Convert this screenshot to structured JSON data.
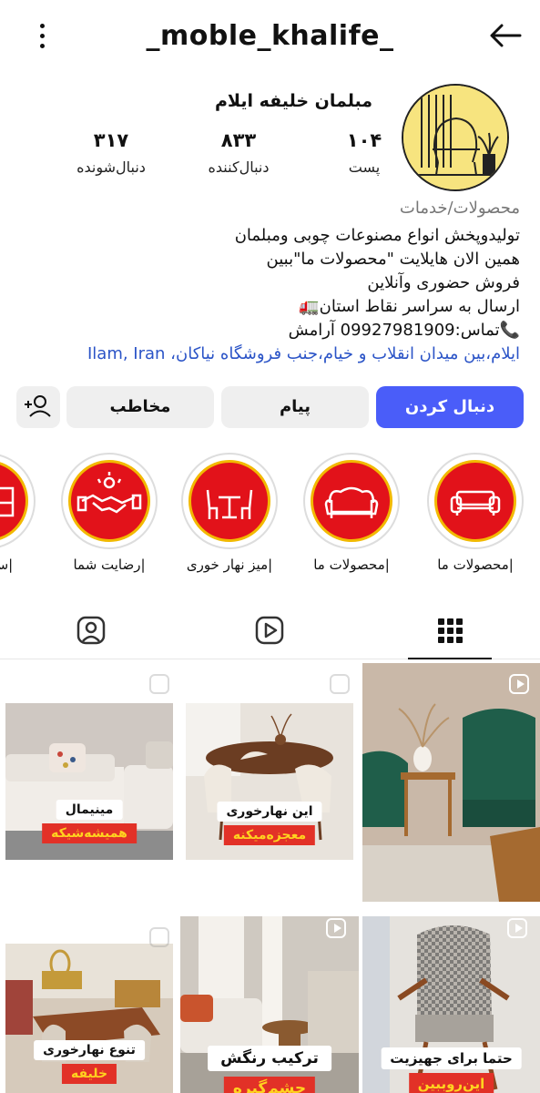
{
  "header": {
    "username": "_moble_khalife_"
  },
  "profile": {
    "display_name": "مبلمان خلیفه ایلام",
    "stats": [
      {
        "value": "۱۰۴",
        "label": "پست"
      },
      {
        "value": "۸۳۳",
        "label": "دنبال‌کننده"
      },
      {
        "value": "۳۱۷",
        "label": "دنبال‌شونده"
      }
    ],
    "category": "محصولات/خدمات",
    "bio": [
      "تولیدوپخش انواع مصنوعات چوبی ومبلمان",
      "همین الان هایلایت \"محصولات ما\"ببین",
      "فروش حضوری وآنلاین",
      "ارسال به سراسر نقاط استان🚛",
      "📞تماس:09927981909 آرامش"
    ],
    "address": "ایلام،بین میدان انقلاب و خیام،جنب فروشگاه نیاکان، Ilam, Iran"
  },
  "actions": {
    "follow": "دنبال کردن",
    "message": "پیام",
    "contact": "مخاطب"
  },
  "highlights": [
    {
      "label": "|محصولات ما",
      "icon": "sofa-icon"
    },
    {
      "label": "|محصولات ما",
      "icon": "classic-sofa-icon"
    },
    {
      "label": "|میز نهار خوری",
      "icon": "dining-table-icon"
    },
    {
      "label": "|رضایت شما",
      "icon": "handshake-icon"
    },
    {
      "label": "|سرویس",
      "icon": "bed-icon"
    }
  ],
  "tabs": [
    "grid-icon",
    "reels-icon",
    "tagged-icon"
  ],
  "posts": [
    {
      "cap1": "",
      "cap2": "",
      "reel": true
    },
    {
      "cap1": "این نهارخوری",
      "cap2": "معجزه‌میکنه",
      "reel": false
    },
    {
      "cap1": "مینیمال",
      "cap2": "همیشه‌شیکه",
      "reel": false
    },
    {
      "cap1": "حتما برای جهیزیت",
      "cap2": "این‌رو‌ببین",
      "reel": true
    },
    {
      "cap1": "ترکیب رنگش",
      "cap2": "چشم‌گیره",
      "reel": true
    },
    {
      "cap1": "تنوع نهارخوری",
      "cap2": "خلیفه",
      "reel": false
    }
  ],
  "colors": {
    "accent": "#4a5df9",
    "highlight_bg": "#e2121a",
    "highlight_ring": "#f2b900",
    "link": "#2b54c7"
  }
}
